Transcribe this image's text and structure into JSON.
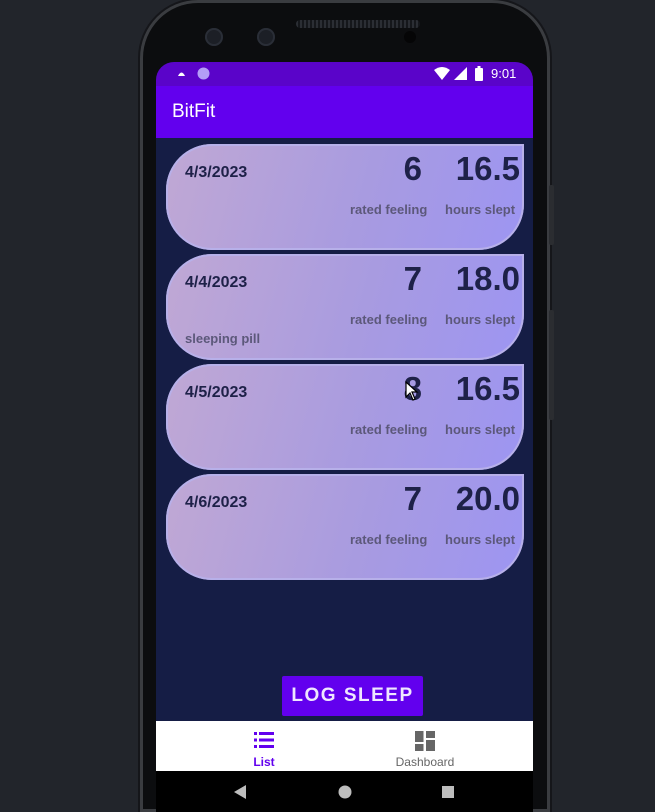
{
  "status_bar": {
    "time": "9:01",
    "icons": [
      "notification-icon",
      "circle-icon",
      "wifi-icon",
      "signal-icon",
      "battery-icon"
    ]
  },
  "app_bar": {
    "title": "BitFit"
  },
  "entries": [
    {
      "date": "4/3/2023",
      "feeling": "6",
      "feeling_label": "rated feeling",
      "hours": "16.5",
      "hours_label": "hours slept",
      "note": ""
    },
    {
      "date": "4/4/2023",
      "feeling": "7",
      "feeling_label": "rated feeling",
      "hours": "18.0",
      "hours_label": "hours slept",
      "note": "sleeping pill"
    },
    {
      "date": "4/5/2023",
      "feeling": "8",
      "feeling_label": "rated feeling",
      "hours": "16.5",
      "hours_label": "hours slept",
      "note": ""
    },
    {
      "date": "4/6/2023",
      "feeling": "7",
      "feeling_label": "rated feeling",
      "hours": "20.0",
      "hours_label": "hours slept",
      "note": ""
    }
  ],
  "log_button": {
    "label": "LOG SLEEP"
  },
  "bottom_nav": {
    "items": [
      {
        "label": "List",
        "icon": "list-icon",
        "selected": true
      },
      {
        "label": "Dashboard",
        "icon": "dashboard-icon",
        "selected": false
      }
    ]
  },
  "system_nav": {
    "icons": [
      "back-icon",
      "home-icon",
      "recents-icon"
    ]
  },
  "colors": {
    "primary": "#6200ee",
    "status_bar": "#5a04c9",
    "background": "#151d45",
    "selected_nav": "#6200ee",
    "unselected_nav": "#666666"
  }
}
